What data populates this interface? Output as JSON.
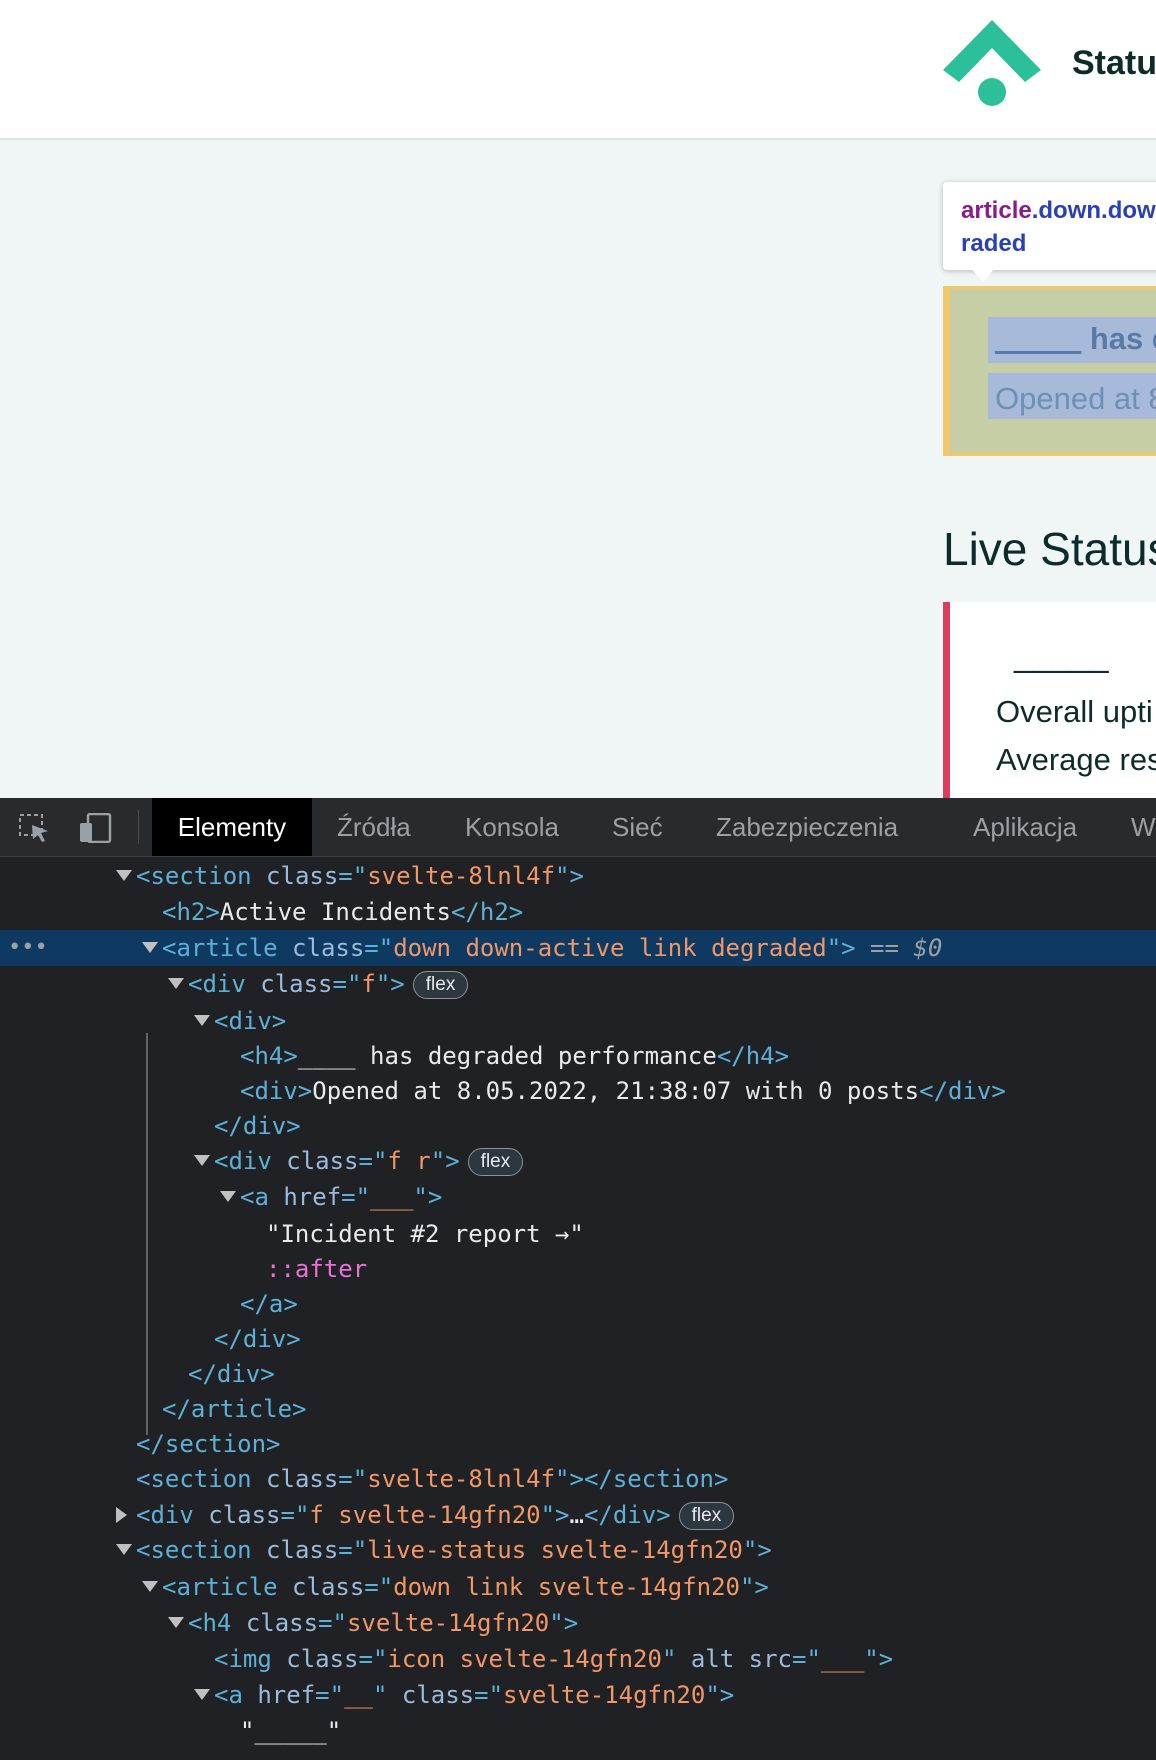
{
  "page": {
    "brand": "Statu",
    "tooltip": {
      "tag": "article",
      "classes": ".down.dow",
      "line2": "raded"
    },
    "incident": {
      "title_blank": "_____",
      "title": " has d",
      "meta": "Opened at 8"
    },
    "live_title": "Live Status",
    "live_card": {
      "name": "_____",
      "row1": "Overall upti",
      "row2": "Average res"
    },
    "colors": {
      "accent": "#2bbf9a",
      "incident_border": "#f2c66b",
      "down_border": "#e03a5c"
    }
  },
  "devtools": {
    "tabs": [
      "Elementy",
      "Źródła",
      "Konsola",
      "Sieć",
      "Zabezpieczenia",
      "Aplikacja",
      "W"
    ],
    "active_tab": "Elementy",
    "icons": [
      "inspect-element-icon",
      "device-toolbar-icon"
    ],
    "dots": "•••",
    "lines": [
      {
        "d": 1,
        "tw": "open",
        "h": "<span class='t'>&lt;section</span> <span class='a'>class</span><span class='t'>=\"</span><span class='v'>svelte-8lnl4f</span><span class='t'>\"&gt;</span>"
      },
      {
        "d": 2,
        "tw": "",
        "h": "<span class='t'>&lt;h2&gt;</span><span class='x'>Active Incidents</span><span class='t'>&lt;/h2&gt;</span>"
      },
      {
        "d": 2,
        "tw": "open",
        "sel": true,
        "h": "<span class='t'>&lt;article</span> <span class='a'>class</span><span class='t'>=\"</span><span class='v'>down down-active link degraded</span><span class='t'>\"&gt;</span> <span class='eq'>== $0</span>"
      },
      {
        "d": 3,
        "tw": "open",
        "h": "<span class='t'>&lt;div</span> <span class='a'>class</span><span class='t'>=\"</span><span class='v'>f</span><span class='t'>\"&gt;</span>",
        "badge": "flex"
      },
      {
        "d": 4,
        "tw": "open",
        "h": "<span class='t'>&lt;div&gt;</span>"
      },
      {
        "d": 5,
        "tw": "",
        "h": "<span class='t'>&lt;h4&gt;</span><span class='x'>____ has degraded performance</span><span class='t'>&lt;/h4&gt;</span>"
      },
      {
        "d": 5,
        "tw": "",
        "h": "<span class='t'>&lt;div&gt;</span><span class='x'>Opened at 8.05.2022, 21:38:07 with 0 posts</span><span class='t'>&lt;/div&gt;</span>"
      },
      {
        "d": 4,
        "tw": "",
        "h": "<span class='t'>&lt;/div&gt;</span>"
      },
      {
        "d": 4,
        "tw": "open",
        "h": "<span class='t'>&lt;div</span> <span class='a'>class</span><span class='t'>=\"</span><span class='v'>f r</span><span class='t'>\"&gt;</span>",
        "badge": "flex"
      },
      {
        "d": 5,
        "tw": "open",
        "h": "<span class='t'>&lt;a</span> <span class='a'>href</span><span class='t'>=\"</span><span class='v'>___</span><span class='t'>\"&gt;</span>"
      },
      {
        "d": 6,
        "tw": "",
        "h": "<span class='x'>\"Incident #2 report →\"</span>"
      },
      {
        "d": 6,
        "tw": "",
        "h": "<span class='ps'>::after</span>"
      },
      {
        "d": 5,
        "tw": "",
        "h": "<span class='t'>&lt;/a&gt;</span>"
      },
      {
        "d": 4,
        "tw": "",
        "h": "<span class='t'>&lt;/div&gt;</span>"
      },
      {
        "d": 3,
        "tw": "",
        "h": "<span class='t'>&lt;/div&gt;</span>"
      },
      {
        "d": 2,
        "tw": "",
        "h": "<span class='t'>&lt;/article&gt;</span>"
      },
      {
        "d": 1,
        "tw": "",
        "h": "<span class='t'>&lt;/section&gt;</span>"
      },
      {
        "d": 1,
        "tw": "",
        "h": "<span class='t'>&lt;section</span> <span class='a'>class</span><span class='t'>=\"</span><span class='v'>svelte-8lnl4f</span><span class='t'>\"&gt;&lt;/section&gt;</span>"
      },
      {
        "d": 1,
        "tw": "closed",
        "h": "<span class='t'>&lt;div</span> <span class='a'>class</span><span class='t'>=\"</span><span class='v'>f svelte-14gfn20</span><span class='t'>\"&gt;</span><span class='x'>…</span><span class='t'>&lt;/div&gt;</span>",
        "badge": "flex"
      },
      {
        "d": 1,
        "tw": "open",
        "h": "<span class='t'>&lt;section</span> <span class='a'>class</span><span class='t'>=\"</span><span class='v'>live-status svelte-14gfn20</span><span class='t'>\"&gt;</span>"
      },
      {
        "d": 2,
        "tw": "open",
        "h": "<span class='t'>&lt;article</span> <span class='a'>class</span><span class='t'>=\"</span><span class='v'>down link svelte-14gfn20</span><span class='t'>\"&gt;</span>"
      },
      {
        "d": 3,
        "tw": "open",
        "h": "<span class='t'>&lt;h4</span> <span class='a'>class</span><span class='t'>=\"</span><span class='v'>svelte-14gfn20</span><span class='t'>\"&gt;</span>"
      },
      {
        "d": 4,
        "tw": "",
        "h": "<span class='t'>&lt;img</span> <span class='a'>class</span><span class='t'>=\"</span><span class='v'>icon svelte-14gfn20</span><span class='t'>\"</span> <span class='a'>alt src</span><span class='t'>=\"</span><span class='v'>___</span><span class='t'>\"&gt;</span>"
      },
      {
        "d": 4,
        "tw": "open",
        "h": "<span class='t'>&lt;a</span> <span class='a'>href</span><span class='t'>=\"</span><span class='v'>__</span><span class='t'>\"</span> <span class='a'>class</span><span class='t'>=\"</span><span class='v'>svelte-14gfn20</span><span class='t'>\"&gt;</span>"
      },
      {
        "d": 5,
        "tw": "",
        "h": "<span class='x'>\"_____\"</span>"
      }
    ]
  }
}
